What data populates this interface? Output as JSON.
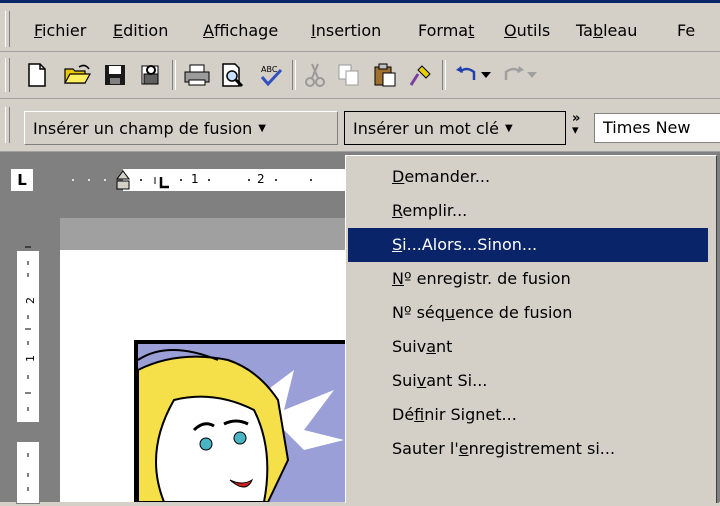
{
  "menubar": {
    "items": [
      {
        "pre": "",
        "u": "F",
        "post": "ichier"
      },
      {
        "pre": "",
        "u": "E",
        "post": "dition"
      },
      {
        "pre": "",
        "u": "A",
        "post": "ffichage"
      },
      {
        "pre": "",
        "u": "I",
        "post": "nsertion"
      },
      {
        "pre": "Forma",
        "u": "t",
        "post": ""
      },
      {
        "pre": "",
        "u": "O",
        "post": "utils"
      },
      {
        "pre": "Ta",
        "u": "b",
        "post": "leau"
      },
      {
        "pre": "Fe",
        "u": "",
        "post": ""
      }
    ]
  },
  "toolbar": {
    "icons": [
      "new-document-icon",
      "open-folder-icon",
      "save-icon",
      "permission-icon",
      "print-icon",
      "print-preview-icon",
      "spelling-icon",
      "cut-icon",
      "copy-icon",
      "paste-icon",
      "format-painter-icon",
      "undo-icon",
      "redo-icon"
    ]
  },
  "mergebar": {
    "insert_merge_field": "Insérer un champ de fusion",
    "insert_word_field": "Insérer un mot clé",
    "font_name": "Times New"
  },
  "ruler": {
    "tab_selector": "L",
    "marks": [
      "1",
      "2"
    ]
  },
  "dropdown": {
    "items": [
      {
        "pre": "",
        "u": "D",
        "post": "emander...",
        "highlighted": false
      },
      {
        "pre": "",
        "u": "R",
        "post": "emplir...",
        "highlighted": false
      },
      {
        "pre": "",
        "u": "S",
        "post": "i...Alors...Sinon...",
        "highlighted": true
      },
      {
        "pre": "",
        "u": "N",
        "post": "º enregistr. de fusion",
        "highlighted": false
      },
      {
        "pre": "Nº séq",
        "u": "u",
        "post": "ence de fusion",
        "highlighted": false
      },
      {
        "pre": "Suiv",
        "u": "a",
        "post": "nt",
        "highlighted": false
      },
      {
        "pre": "Sui",
        "u": "v",
        "post": "ant Si...",
        "highlighted": false
      },
      {
        "pre": "Dé",
        "u": "f",
        "post": "inir Signet...",
        "highlighted": false
      },
      {
        "pre": "Sauter l'",
        "u": "e",
        "post": "nregistrement si...",
        "highlighted": false
      }
    ]
  },
  "colors": {
    "highlight": "#0a246a",
    "face": "#d4d0c8"
  }
}
